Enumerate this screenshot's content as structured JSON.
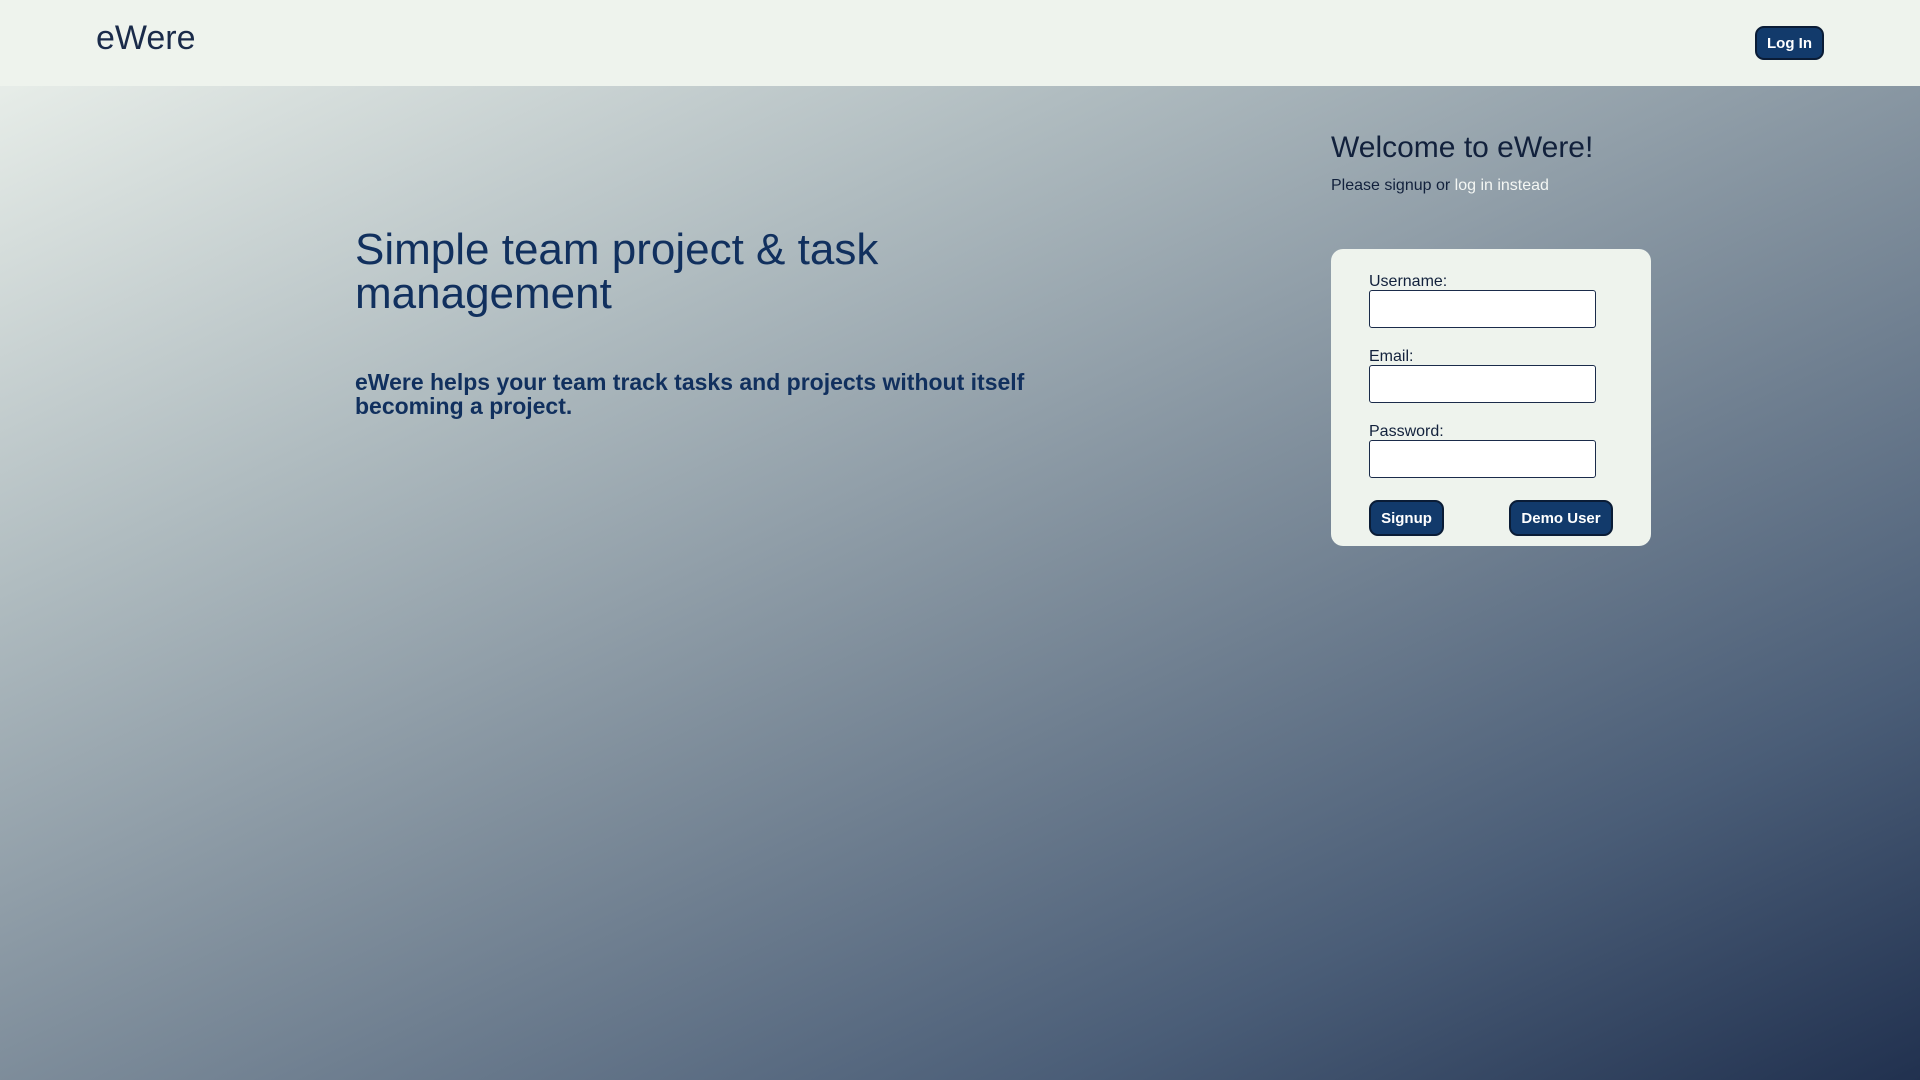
{
  "header": {
    "brand": "eWere",
    "login_label": "Log In"
  },
  "hero": {
    "title": "Simple team project & task management",
    "subtitle": "eWere helps your team track tasks and projects without itself becoming a project."
  },
  "welcome": {
    "title": "Welcome to eWere!",
    "prompt_prefix": "Please signup or ",
    "login_link": "log in instead"
  },
  "form": {
    "username_label": "Username:",
    "username_value": "",
    "email_label": "Email:",
    "email_value": "",
    "password_label": "Password:",
    "password_value": "",
    "signup_label": "Signup",
    "demo_label": "Demo User"
  },
  "colors": {
    "accent": "#123a6b",
    "text_dark": "#12213c",
    "heading_blue": "#11305e",
    "panel": "#eef3ed"
  }
}
